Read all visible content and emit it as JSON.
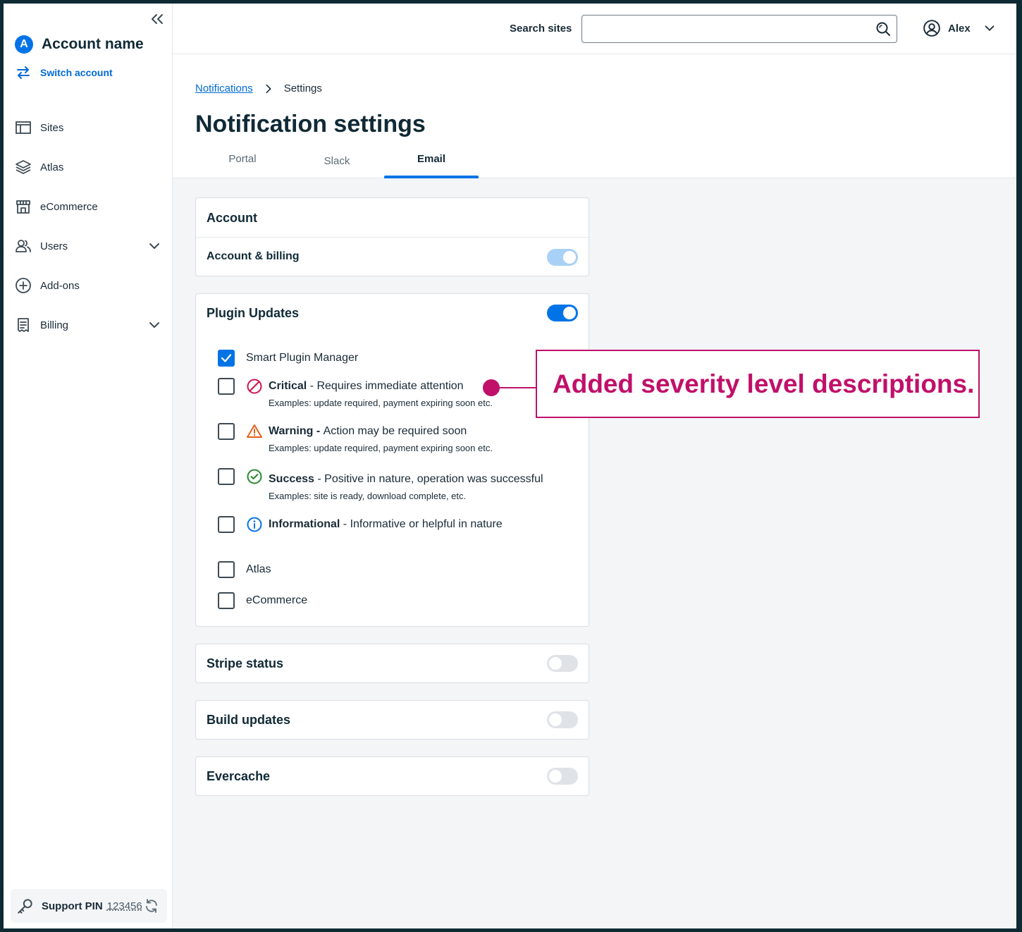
{
  "sidebar": {
    "account_initial": "A",
    "account_name": "Account name",
    "switch_account": "Switch account",
    "nav": [
      {
        "label": "Sites",
        "icon": "sites-icon",
        "has_chevron": false
      },
      {
        "label": "Atlas",
        "icon": "layers-icon",
        "has_chevron": false
      },
      {
        "label": "eCommerce",
        "icon": "store-icon",
        "has_chevron": false
      },
      {
        "label": "Users",
        "icon": "users-icon",
        "has_chevron": true
      },
      {
        "label": "Add-ons",
        "icon": "plus-circle-icon",
        "has_chevron": false
      },
      {
        "label": "Billing",
        "icon": "receipt-icon",
        "has_chevron": true
      }
    ],
    "support_pin_label": "Support PIN",
    "support_pin_value": "123456"
  },
  "header": {
    "search_label": "Search sites",
    "search_value": "",
    "user_name": "Alex"
  },
  "breadcrumb": {
    "parent": "Notifications",
    "current": "Settings"
  },
  "page_title": "Notification settings",
  "tabs": [
    {
      "label": "Portal",
      "active": false
    },
    {
      "label": "Slack",
      "active": false
    },
    {
      "label": "Email",
      "active": true
    }
  ],
  "account_card": {
    "title": "Account",
    "row_label": "Account & billing",
    "toggle_state": "on-disabled"
  },
  "plugin_card": {
    "title": "Plugin Updates",
    "toggle_state": "on",
    "smart_plugin_manager": {
      "label": "Smart Plugin Manager",
      "checked": true
    },
    "severities": [
      {
        "name": "Critical",
        "sep": " - ",
        "desc": "Requires immediate attention",
        "example": "Examples: update required, payment expiring soon etc.",
        "icon": "critical-icon",
        "checked": false
      },
      {
        "name": "Warning -",
        "sep": " ",
        "desc": "Action may be required soon",
        "example": "Examples: update required, payment expiring soon etc.",
        "icon": "warning-icon",
        "checked": false
      },
      {
        "name": "Success",
        "sep": " - ",
        "desc": "Positive in nature, operation was successful",
        "example": "Examples: site is ready, download complete, etc.",
        "icon": "success-icon",
        "checked": false
      },
      {
        "name": "Informational",
        "sep": " - ",
        "desc": "Informative or helpful in nature",
        "example": "",
        "icon": "info-icon",
        "checked": false
      }
    ],
    "other": [
      {
        "label": "Atlas",
        "checked": false
      },
      {
        "label": "eCommerce",
        "checked": false
      }
    ]
  },
  "simple_cards": [
    {
      "title": "Stripe status",
      "toggle_state": "off"
    },
    {
      "title": "Build updates",
      "toggle_state": "off"
    },
    {
      "title": "Evercache",
      "toggle_state": "off"
    }
  ],
  "annotation": "Added severity level descriptions.",
  "colors": {
    "primary": "#0073e6",
    "annotation": "#c0106a",
    "critical": "#d0134d",
    "warning": "#e5601e",
    "success": "#27892f",
    "info": "#0073e6"
  }
}
